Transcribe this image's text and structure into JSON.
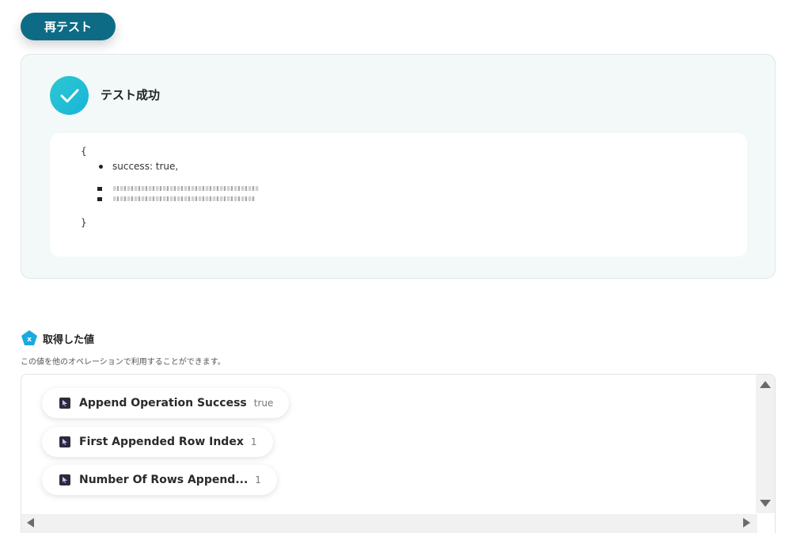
{
  "retest_button": {
    "label": "再テスト"
  },
  "test_result": {
    "title": "テスト成功",
    "open_brace": "{",
    "close_brace": "}",
    "success_line": "success: true,",
    "icon": "checkmark-icon"
  },
  "obtained_values": {
    "title": "取得した値",
    "icon": "pentagon-x-icon",
    "description": "この値を他のオペレーションで利用することができます。",
    "items": [
      {
        "label": "Append Operation Success",
        "value": "true"
      },
      {
        "label": "First Appended Row Index",
        "value": "1"
      },
      {
        "label": "Number Of Rows Append...",
        "value": "1"
      }
    ]
  },
  "colors": {
    "retest_button": "#0e6b86",
    "success_icon": "#1fbcd6",
    "panel_background": "#f3f9f9",
    "values_icon": "#1aa9e0"
  }
}
